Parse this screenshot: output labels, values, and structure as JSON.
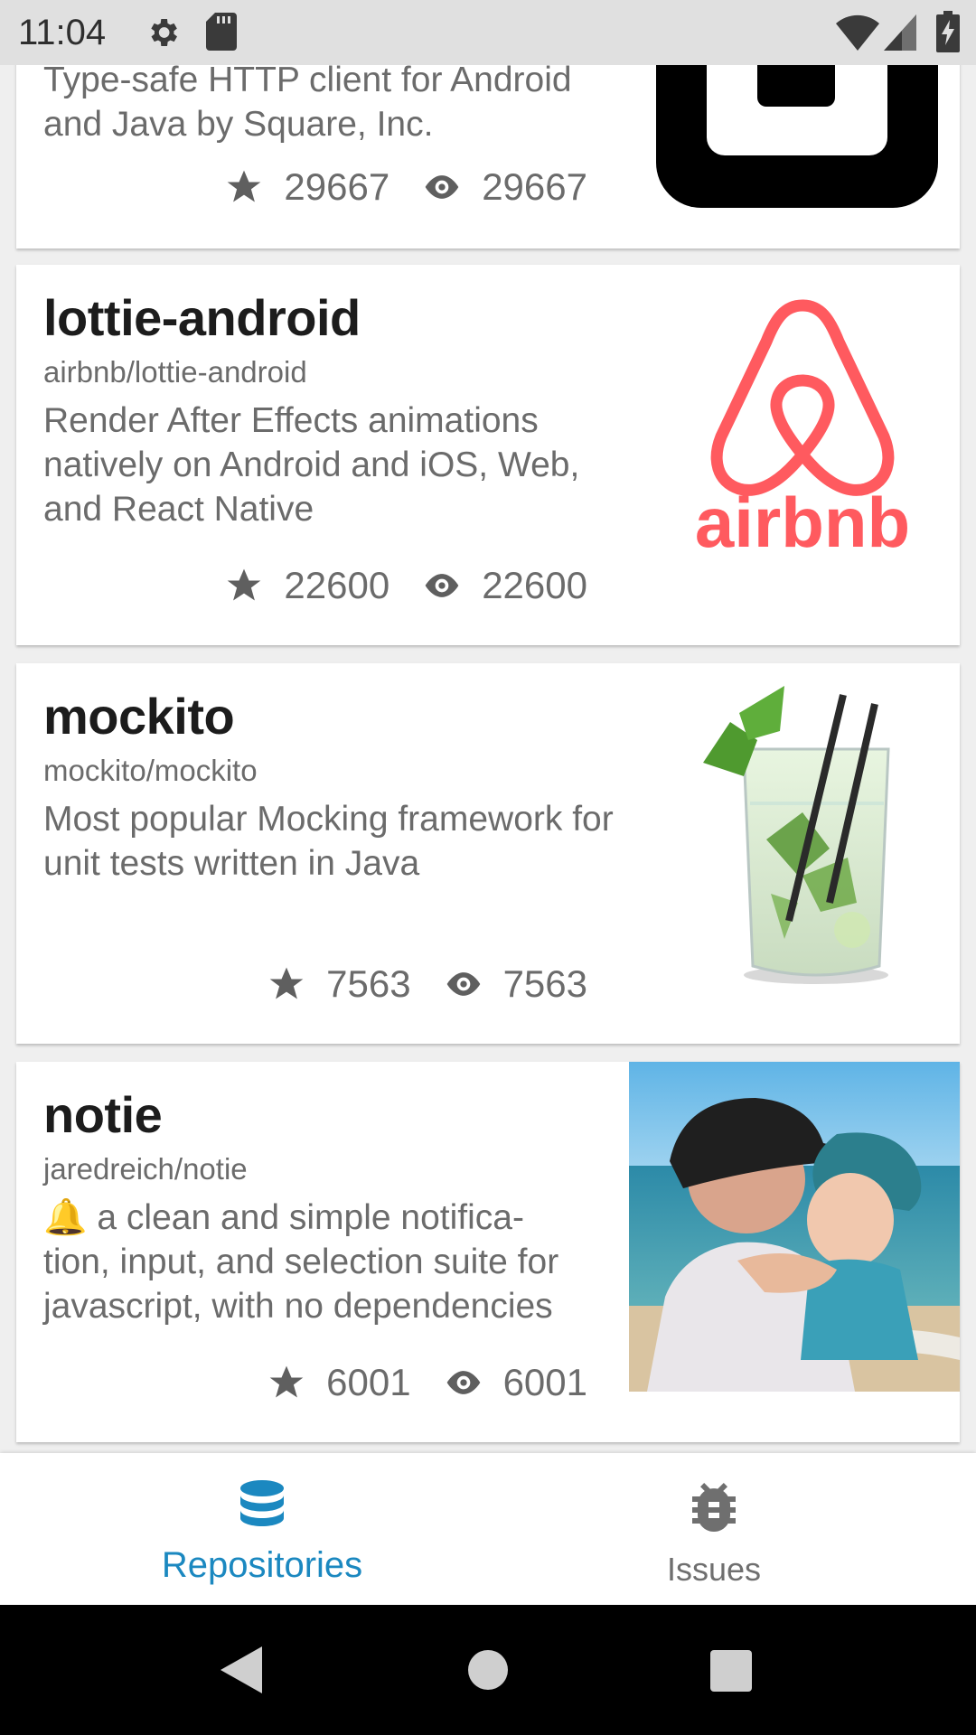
{
  "status_bar": {
    "time": "11:04",
    "icons": [
      "gear-icon",
      "sd-card-icon",
      "wifi-icon",
      "signal-icon",
      "battery-icon"
    ]
  },
  "repositories": [
    {
      "title": "",
      "path": "",
      "description": "Type-safe HTTP client for Android and Java by Square, Inc.",
      "stars": "29667",
      "watchers": "29667",
      "thumbnail": "square-logo"
    },
    {
      "title": "lottie-android",
      "path": "airbnb/lottie-android",
      "description": "Render After Effects animations natively on Android and iOS, Web, and React Native",
      "stars": "22600",
      "watchers": "22600",
      "thumbnail": "airbnb-logo",
      "logo_text": "airbnb"
    },
    {
      "title": "mockito",
      "path": "mockito/mockito",
      "description": "Most popular Mocking framework for unit tests written in Java",
      "stars": "7563",
      "watchers": "7563",
      "thumbnail": "mojito-glass-image"
    },
    {
      "title": "notie",
      "path": "jaredreich/notie",
      "description": "🔔 a clean and simple notification, input, and selection suite for javascript, with no dependencies",
      "description_lines": [
        "🔔 a clean and simple notifica-",
        "tion, input, and selection suite for",
        "javascript, with no dependencies"
      ],
      "stars": "6001",
      "watchers": "6001",
      "thumbnail": "beach-photo"
    }
  ],
  "bottom_nav": {
    "tabs": [
      {
        "label": "Repositories",
        "icon": "database-icon",
        "active": true
      },
      {
        "label": "Issues",
        "icon": "bug-icon",
        "active": false
      }
    ]
  },
  "colors": {
    "accent": "#1b88c0",
    "airbnb": "#ff5a5f",
    "inactive": "#6f6f6f"
  }
}
